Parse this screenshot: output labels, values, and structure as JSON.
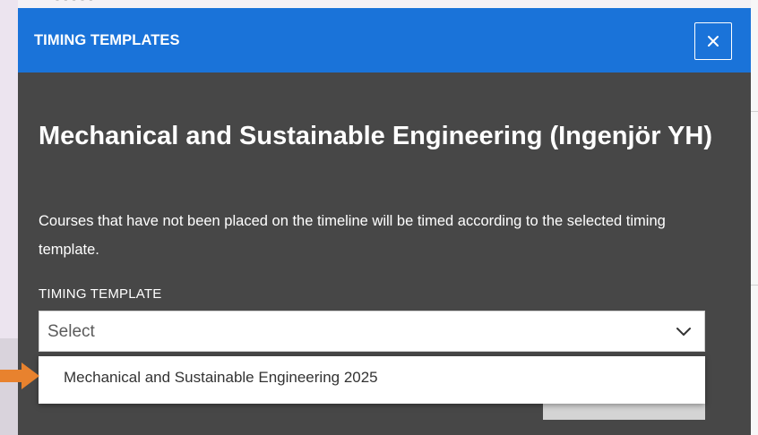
{
  "modal": {
    "title": "TIMING TEMPLATES",
    "close_icon": "close-icon",
    "program_title": "Mechanical and Sustainable Engineering (Ingenjör YH)",
    "description": "Courses that have not been placed on the timeline will be timed according to the selected timing template.",
    "field_label": "TIMING TEMPLATE",
    "select": {
      "value": "Select",
      "icon": "chevron-down-icon"
    },
    "dropdown_options": [
      {
        "label": "Mechanical and Sustainable Engineering 2025"
      }
    ]
  },
  "colors": {
    "header": "#1a73d9",
    "modal_body": "#474747",
    "annotation_arrow": "#e8822e"
  },
  "annotation": {
    "icon": "arrow-right-icon"
  }
}
